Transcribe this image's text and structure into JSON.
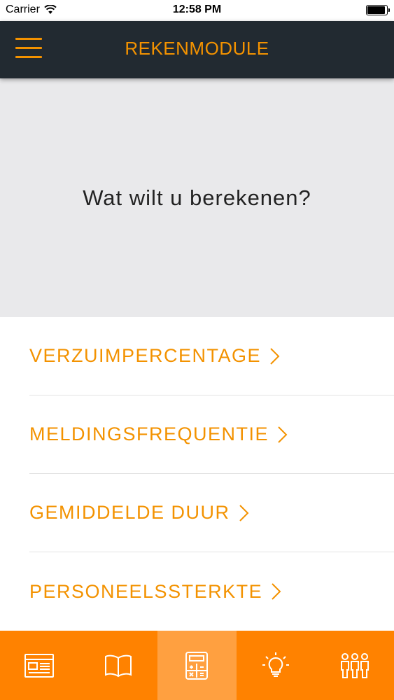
{
  "status_bar": {
    "carrier": "Carrier",
    "time": "12:58 PM",
    "battery_level": 0.95
  },
  "colors": {
    "accent": "#f39200",
    "nav_bg": "#222a31",
    "tab_bg": "#ff8200",
    "tab_active_bg": "#ffa040",
    "hero_bg": "#e9e9eb"
  },
  "header": {
    "menu_icon": "hamburger-menu-icon",
    "title": "REKENMODULE"
  },
  "hero": {
    "question": "Wat wilt u berekenen?"
  },
  "menu": {
    "items": [
      {
        "label": "VERZUIMPERCENTAGE"
      },
      {
        "label": "MELDINGSFREQUENTIE"
      },
      {
        "label": "GEMIDDELDE DUUR"
      },
      {
        "label": "PERSONEELSSTERKTE"
      }
    ]
  },
  "tab_bar": {
    "active_index": 2,
    "tabs": [
      {
        "icon": "newspaper-icon"
      },
      {
        "icon": "book-icon"
      },
      {
        "icon": "calculator-icon"
      },
      {
        "icon": "lightbulb-icon"
      },
      {
        "icon": "people-icon"
      }
    ]
  }
}
